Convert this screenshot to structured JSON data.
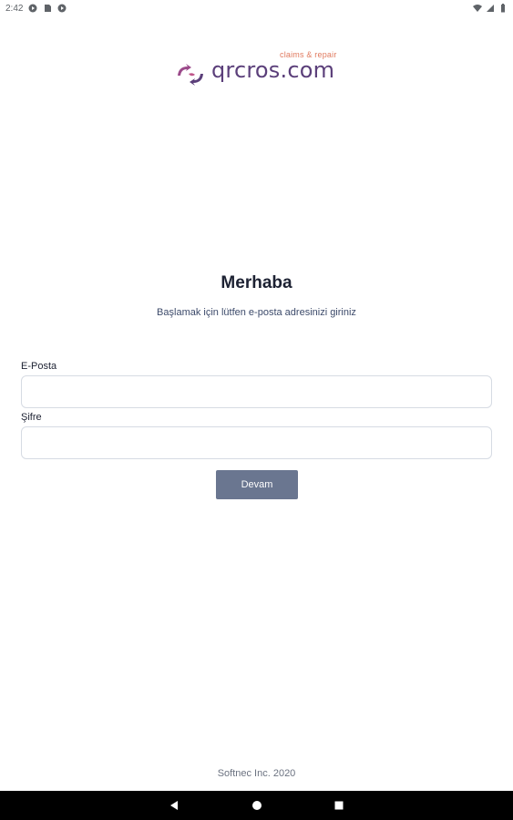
{
  "status_bar": {
    "time": "2:42",
    "icons_left": [
      "app-icon",
      "sim-icon",
      "app-icon"
    ],
    "icons_right": [
      "wifi-icon",
      "signal-icon",
      "battery-icon"
    ]
  },
  "logo": {
    "tagline": "claims & repair",
    "text": "qrcros.com",
    "brand_color": "#5b3f7a",
    "accent_color": "#e07a5f"
  },
  "login": {
    "title": "Merhaba",
    "subtitle": "Başlamak için lütfen e-posta adresinizi giriniz",
    "email_label": "E-Posta",
    "email_value": "",
    "password_label": "Şifre",
    "password_value": "",
    "submit_label": "Devam"
  },
  "footer": {
    "text": "Softnec Inc. 2020"
  },
  "nav_bar": {
    "buttons": [
      "back-icon",
      "home-icon",
      "recents-icon"
    ]
  }
}
